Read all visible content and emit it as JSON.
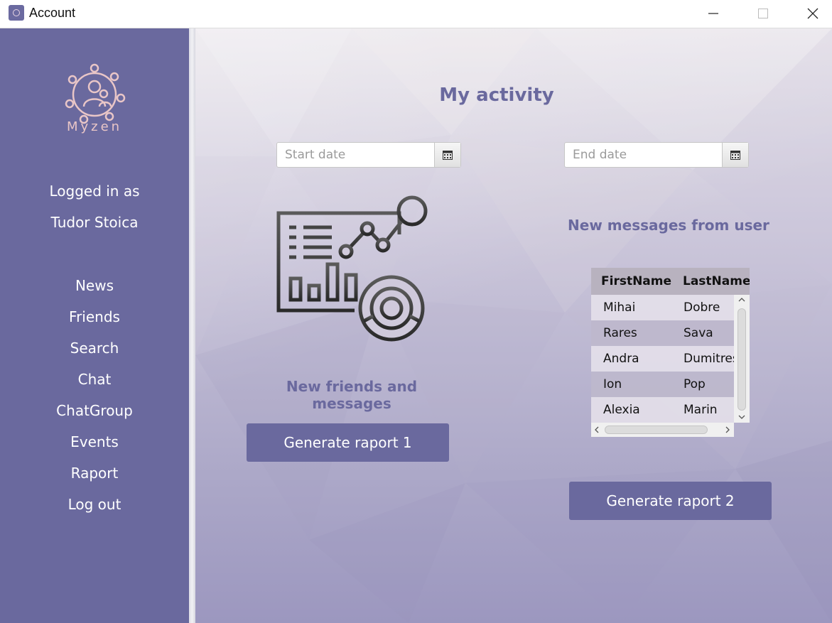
{
  "window": {
    "title": "Account",
    "controls": {
      "minimize": "—",
      "maximize": "☐",
      "close": "✕"
    }
  },
  "sidebar": {
    "logo_text": "Myzen",
    "logged_in_label": "Logged in as",
    "user_name": "Tudor Stoica",
    "items": [
      {
        "label": "News"
      },
      {
        "label": "Friends"
      },
      {
        "label": "Search"
      },
      {
        "label": "Chat"
      },
      {
        "label": "ChatGroup"
      },
      {
        "label": "Events"
      },
      {
        "label": "Raport"
      },
      {
        "label": "Log out"
      }
    ]
  },
  "main": {
    "heading": "My activity",
    "start_date_placeholder": "Start date",
    "end_date_placeholder": "End date",
    "left_label": "New friends and messages",
    "right_label": "New messages from user",
    "button1": "Generate raport 1",
    "button2": "Generate raport 2",
    "table": {
      "columns": [
        "FirstName",
        "LastName"
      ],
      "rows": [
        [
          "Mihai",
          "Dobre"
        ],
        [
          "Rares",
          "Sava"
        ],
        [
          "Andra",
          "Dumitrescu"
        ],
        [
          "Ion",
          "Pop"
        ],
        [
          "Alexia",
          "Marin"
        ]
      ]
    }
  },
  "colors": {
    "accent": "#6a699e",
    "logo": "#e9c6c7"
  },
  "icons": {
    "app": "app-logo-icon",
    "calendar": "calendar-icon",
    "illustration": "analytics-dashboard-icon"
  }
}
